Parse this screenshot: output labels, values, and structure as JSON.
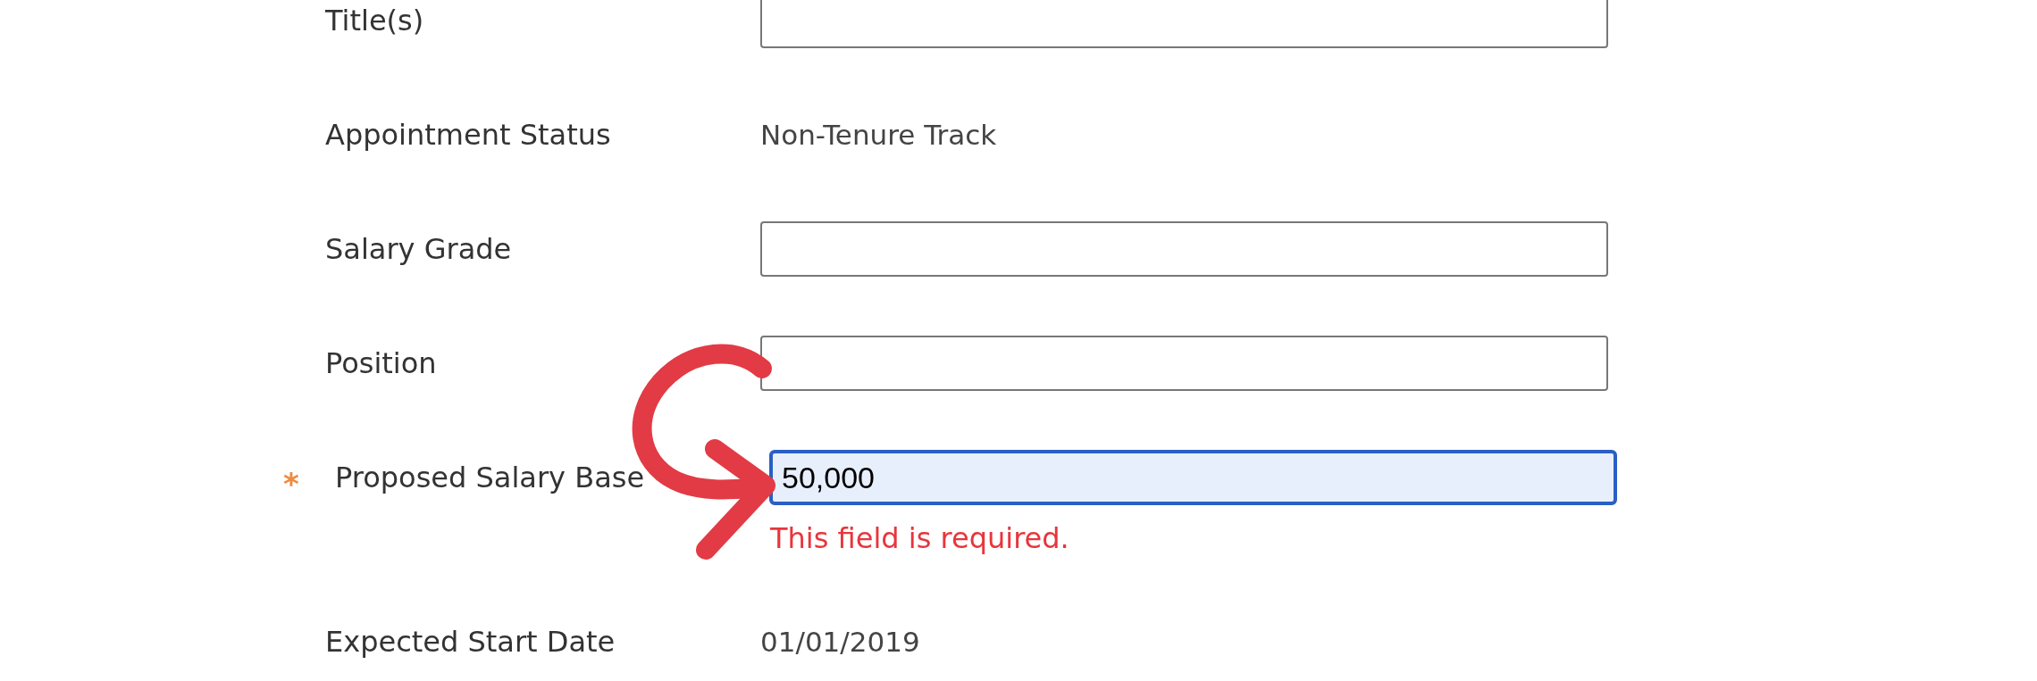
{
  "fields": [
    {
      "label": "Title(s)",
      "kind": "input"
    },
    {
      "label": "Appointment Status",
      "kind": "static",
      "value": "Non-Tenure Track"
    },
    {
      "label": "Salary Grade",
      "kind": "input"
    },
    {
      "label": "Position",
      "kind": "input"
    },
    {
      "label": "Proposed Salary Base",
      "kind": "input",
      "value": "50,000",
      "required": true,
      "required_mark": "*",
      "focused": true,
      "error": "This field is required."
    },
    {
      "label": "Expected Start Date",
      "kind": "static",
      "value": "01/01/2019"
    }
  ]
}
